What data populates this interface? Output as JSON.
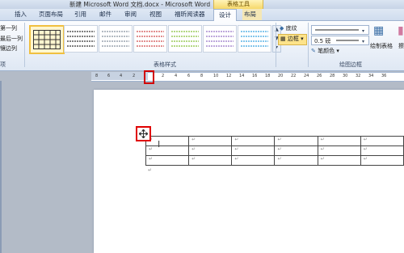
{
  "title_bar": {
    "title": "新建 Microsoft Word 文档.docx - Microsoft Word",
    "tools_tab": "表格工具"
  },
  "tabs": [
    "插入",
    "页面布局",
    "引用",
    "邮件",
    "审阅",
    "视图",
    "福昕阅读器",
    "设计",
    "布局"
  ],
  "active_tab": "设计",
  "ribbon": {
    "left_group": {
      "items": [
        "第一列",
        "最后一列",
        "镶边列"
      ],
      "label": "项"
    },
    "table_styles_label": "表格样式",
    "shading_label": "底纹",
    "borders_label": "边框",
    "pen_weight": "0.5 磅",
    "pen_color": "笔颜色",
    "draw_table": "绘制表格",
    "eraser": "擦",
    "draw_borders_label": "绘图边框"
  },
  "ruler": {
    "ticks": [
      "8",
      "6",
      "4",
      "2",
      "",
      "2",
      "4",
      "6",
      "8",
      "10",
      "12",
      "14",
      "16",
      "18",
      "20",
      "22",
      "24",
      "26",
      "28",
      "30",
      "32",
      "34",
      "36"
    ]
  },
  "document": {
    "table": {
      "rows": 3,
      "cols": 6,
      "cell_mark": "↵"
    },
    "after_table_mark": "↵"
  },
  "colors": {
    "accent_red": "#e00000",
    "tools_tab": "#f6d86a",
    "selected_style": "#f0c040"
  }
}
